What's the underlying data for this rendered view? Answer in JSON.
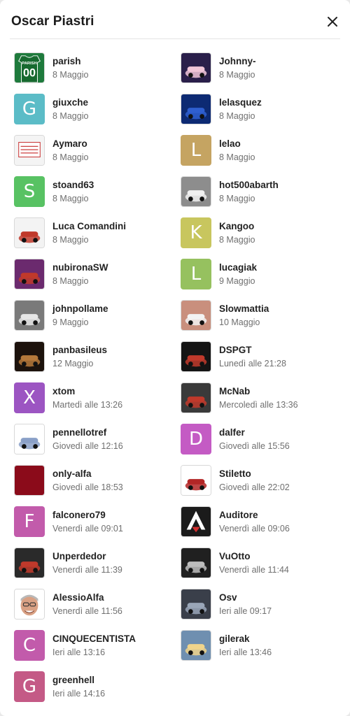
{
  "dialog": {
    "title": "Oscar Piastri",
    "close_icon": "close-icon"
  },
  "left": [
    {
      "name": "parish",
      "date": "8 Maggio",
      "avatar": {
        "type": "jersey",
        "text": "PARISH",
        "number": "00",
        "color": "#1e7a3c"
      }
    },
    {
      "name": "giuxche",
      "date": "8 Maggio",
      "avatar": {
        "type": "letter",
        "letter": "G",
        "color": "#5bbcc7"
      }
    },
    {
      "name": "Aymaro",
      "date": "8 Maggio",
      "avatar": {
        "type": "stamp",
        "text": "immagine profilo non pervenuta"
      }
    },
    {
      "name": "stoand63",
      "date": "8 Maggio",
      "avatar": {
        "type": "letter",
        "letter": "S",
        "color": "#58c263"
      }
    },
    {
      "name": "Luca Comandini",
      "date": "8 Maggio",
      "avatar": {
        "type": "photo",
        "bg": "#f3f3f3",
        "fg": "#c0392b"
      }
    },
    {
      "name": "nubironaSW",
      "date": "8 Maggio",
      "avatar": {
        "type": "photo",
        "bg": "#6b2a6e",
        "fg": "#c0392b"
      }
    },
    {
      "name": "johnpollame",
      "date": "9 Maggio",
      "avatar": {
        "type": "photo",
        "bg": "#7a7a7a",
        "fg": "#e6e6e6"
      }
    },
    {
      "name": "panbasileus",
      "date": "12 Maggio",
      "avatar": {
        "type": "photo",
        "bg": "#1c120c",
        "fg": "#b5793b"
      }
    },
    {
      "name": "xtom",
      "date": "Martedì alle 13:26",
      "avatar": {
        "type": "letter",
        "letter": "X",
        "color": "#9c55c2"
      }
    },
    {
      "name": "pennellotref",
      "date": "Giovedì alle 12:16",
      "avatar": {
        "type": "photo",
        "bg": "#ffffff",
        "fg": "#8aa0c8"
      }
    },
    {
      "name": "only-alfa",
      "date": "Giovedì alle 18:53",
      "avatar": {
        "type": "solid",
        "color": "#8b0b1a"
      }
    },
    {
      "name": "falconero79",
      "date": "Venerdì alle 09:01",
      "avatar": {
        "type": "letter",
        "letter": "F",
        "color": "#c25bab"
      }
    },
    {
      "name": "Unperdedor",
      "date": "Venerdì alle 11:39",
      "avatar": {
        "type": "photo",
        "bg": "#2a2a2a",
        "fg": "#c0392b"
      }
    },
    {
      "name": "AlessioAlfa",
      "date": "Venerdì alle 11:56",
      "avatar": {
        "type": "face",
        "bg": "#ffffff",
        "fg": "#d9a184"
      }
    },
    {
      "name": "CINQUECENTISTA",
      "date": "Ieri alle 13:16",
      "avatar": {
        "type": "letter",
        "letter": "C",
        "color": "#c25bab"
      }
    },
    {
      "name": "greenhell",
      "date": "Ieri alle 14:16",
      "avatar": {
        "type": "letter",
        "letter": "G",
        "color": "#c45a86"
      }
    }
  ],
  "right": [
    {
      "name": "Johnny-",
      "date": "8 Maggio",
      "avatar": {
        "type": "photo",
        "bg": "#2a1f4a",
        "fg": "#f1c6d8"
      }
    },
    {
      "name": "lelasquez",
      "date": "8 Maggio",
      "avatar": {
        "type": "photo",
        "bg": "#0d2a73",
        "fg": "#2f5fd0"
      }
    },
    {
      "name": "lelao",
      "date": "8 Maggio",
      "avatar": {
        "type": "letter",
        "letter": "L",
        "color": "#c5a462"
      }
    },
    {
      "name": "hot500abarth",
      "date": "8 Maggio",
      "avatar": {
        "type": "photo",
        "bg": "#8d8d8d",
        "fg": "#f0f0f0"
      }
    },
    {
      "name": "Kangoo",
      "date": "8 Maggio",
      "avatar": {
        "type": "letter",
        "letter": "K",
        "color": "#c8c65e"
      }
    },
    {
      "name": "lucagiak",
      "date": "9 Maggio",
      "avatar": {
        "type": "letter",
        "letter": "L",
        "color": "#96c15f"
      }
    },
    {
      "name": "Slowmattia",
      "date": "10 Maggio",
      "avatar": {
        "type": "photo",
        "bg": "#c98f7d",
        "fg": "#f3f3f3"
      }
    },
    {
      "name": "DSPGT",
      "date": "Lunedì alle 21:28",
      "avatar": {
        "type": "photo",
        "bg": "#141414",
        "fg": "#c0392b"
      }
    },
    {
      "name": "McNab",
      "date": "Mercoledì alle 13:36",
      "avatar": {
        "type": "photo",
        "bg": "#3a3a3a",
        "fg": "#c0392b"
      }
    },
    {
      "name": "dalfer",
      "date": "Giovedì alle 15:56",
      "avatar": {
        "type": "letter",
        "letter": "D",
        "color": "#c45bc4"
      }
    },
    {
      "name": "Stiletto",
      "date": "Giovedì alle 22:02",
      "avatar": {
        "type": "photo",
        "bg": "#ffffff",
        "fg": "#b32626"
      }
    },
    {
      "name": "Auditore",
      "date": "Venerdì alle 09:06",
      "avatar": {
        "type": "logo",
        "bg": "#1b1b1b",
        "fg": "#ffffff"
      }
    },
    {
      "name": "VuOtto",
      "date": "Venerdì alle 11:44",
      "avatar": {
        "type": "photo",
        "bg": "#202020",
        "fg": "#bdbdbd"
      }
    },
    {
      "name": "Osv",
      "date": "Ieri alle 09:17",
      "avatar": {
        "type": "photo",
        "bg": "#3a3f4a",
        "fg": "#9aa6b8"
      }
    },
    {
      "name": "gilerak",
      "date": "Ieri alle 13:46",
      "avatar": {
        "type": "photo",
        "bg": "#6f8fb0",
        "fg": "#f0d48b"
      }
    }
  ]
}
